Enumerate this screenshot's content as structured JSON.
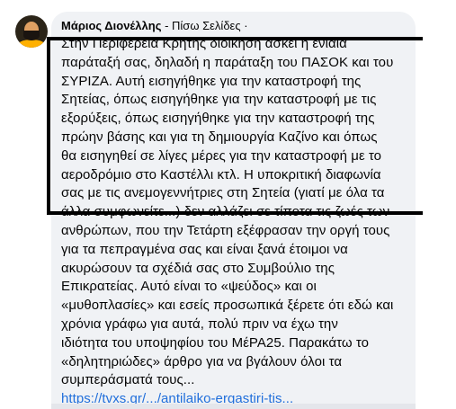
{
  "comment": {
    "author": "Μάριος Διονέλλης",
    "separator": " - ",
    "affiliation": "Πίσω Σελίδες",
    "dot": " ·",
    "lines": [
      "Στην Περιφέρεια Κρήτης διοίκηση ασκεί η ενιαία",
      "παράταξή σας, δηλαδή η παράταξη του ΠΑΣΟΚ και του",
      "ΣΥΡΙΖΑ. Αυτή εισηγήθηκε για την καταστροφή της",
      "Σητείας, όπως εισηγήθηκε για την καταστροφή με τις",
      "εξορύξεις, όπως εισηγήθηκε για την καταστροφή της",
      "πρώην βάσης και για τη δημιουργία Καζίνο και όπως",
      "θα εισηγηθεί σε λίγες μέρες για την καταστροφή με το",
      "αεροδρόμιο στο Καστέλλι κτλ. Η υποκριτική διαφωνία",
      "σας με τις ανεμογεννήτριες στη Σητεία (γιατί με όλα τα",
      "άλλα συμφωνείτε...) δεν αλλάζει σε τίποτα τις ζωές των",
      "ανθρώπων, που την Τετάρτη εξέφρασαν την οργή τους",
      "για τα πεπραγμένα σας και είναι ξανά έτοιμοι να",
      "ακυρώσουν τα σχέδιά σας στο Συμβούλιο της",
      "Επικρατείας. Αυτό είναι το «ψεύδος» και οι",
      "«μυθοπλασίες» και εσείς προσωπικά ξέρετε ότι εδώ και",
      "χρόνια γράφω για αυτά, πολύ πριν να έχω την",
      "ιδιότητα του υποψηφίου του ΜέΡΑ25. Παρακάτω το",
      "«δηλητηριώδες» άρθρο για να βγάλουν όλοι τα",
      "συμπεράσματά τους..."
    ],
    "link": "https://tvxs.gr/.../antilaiko-ergastiri-tis..."
  }
}
